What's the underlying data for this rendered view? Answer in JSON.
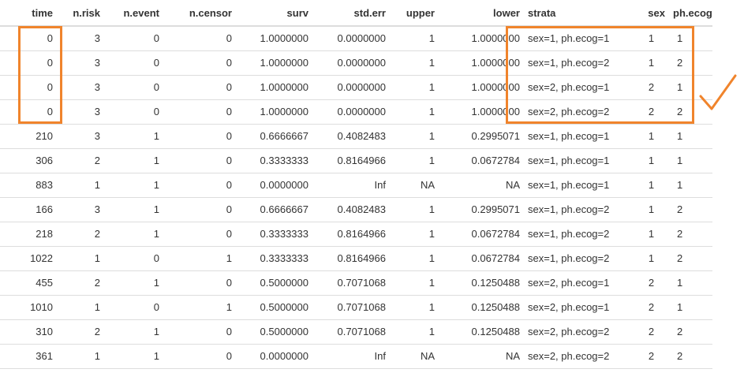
{
  "table": {
    "columns": [
      "time",
      "n.risk",
      "n.event",
      "n.censor",
      "surv",
      "std.err",
      "upper",
      "lower",
      "strata",
      "sex",
      "ph.ecog"
    ],
    "rows": [
      [
        "0",
        "3",
        "0",
        "0",
        "1.0000000",
        "0.0000000",
        "1",
        "1.0000000",
        "sex=1, ph.ecog=1",
        "1",
        "1"
      ],
      [
        "0",
        "3",
        "0",
        "0",
        "1.0000000",
        "0.0000000",
        "1",
        "1.0000000",
        "sex=1, ph.ecog=2",
        "1",
        "2"
      ],
      [
        "0",
        "3",
        "0",
        "0",
        "1.0000000",
        "0.0000000",
        "1",
        "1.0000000",
        "sex=2, ph.ecog=1",
        "2",
        "1"
      ],
      [
        "0",
        "3",
        "0",
        "0",
        "1.0000000",
        "0.0000000",
        "1",
        "1.0000000",
        "sex=2, ph.ecog=2",
        "2",
        "2"
      ],
      [
        "210",
        "3",
        "1",
        "0",
        "0.6666667",
        "0.4082483",
        "1",
        "0.2995071",
        "sex=1, ph.ecog=1",
        "1",
        "1"
      ],
      [
        "306",
        "2",
        "1",
        "0",
        "0.3333333",
        "0.8164966",
        "1",
        "0.0672784",
        "sex=1, ph.ecog=1",
        "1",
        "1"
      ],
      [
        "883",
        "1",
        "1",
        "0",
        "0.0000000",
        "Inf",
        "NA",
        "NA",
        "sex=1, ph.ecog=1",
        "1",
        "1"
      ],
      [
        "166",
        "3",
        "1",
        "0",
        "0.6666667",
        "0.4082483",
        "1",
        "0.2995071",
        "sex=1, ph.ecog=2",
        "1",
        "2"
      ],
      [
        "218",
        "2",
        "1",
        "0",
        "0.3333333",
        "0.8164966",
        "1",
        "0.0672784",
        "sex=1, ph.ecog=2",
        "1",
        "2"
      ],
      [
        "1022",
        "1",
        "0",
        "1",
        "0.3333333",
        "0.8164966",
        "1",
        "0.0672784",
        "sex=1, ph.ecog=2",
        "1",
        "2"
      ],
      [
        "455",
        "2",
        "1",
        "0",
        "0.5000000",
        "0.7071068",
        "1",
        "0.1250488",
        "sex=2, ph.ecog=1",
        "2",
        "1"
      ],
      [
        "1010",
        "1",
        "0",
        "1",
        "0.5000000",
        "0.7071068",
        "1",
        "0.1250488",
        "sex=2, ph.ecog=1",
        "2",
        "1"
      ],
      [
        "310",
        "2",
        "1",
        "0",
        "0.5000000",
        "0.7071068",
        "1",
        "0.1250488",
        "sex=2, ph.ecog=2",
        "2",
        "2"
      ],
      [
        "361",
        "1",
        "1",
        "0",
        "0.0000000",
        "Inf",
        "NA",
        "NA",
        "sex=2, ph.ecog=2",
        "2",
        "2"
      ]
    ]
  },
  "annotations": {
    "color": "#f0842c",
    "marks": [
      "highlight-box",
      "highlight-box",
      "check-mark"
    ]
  }
}
